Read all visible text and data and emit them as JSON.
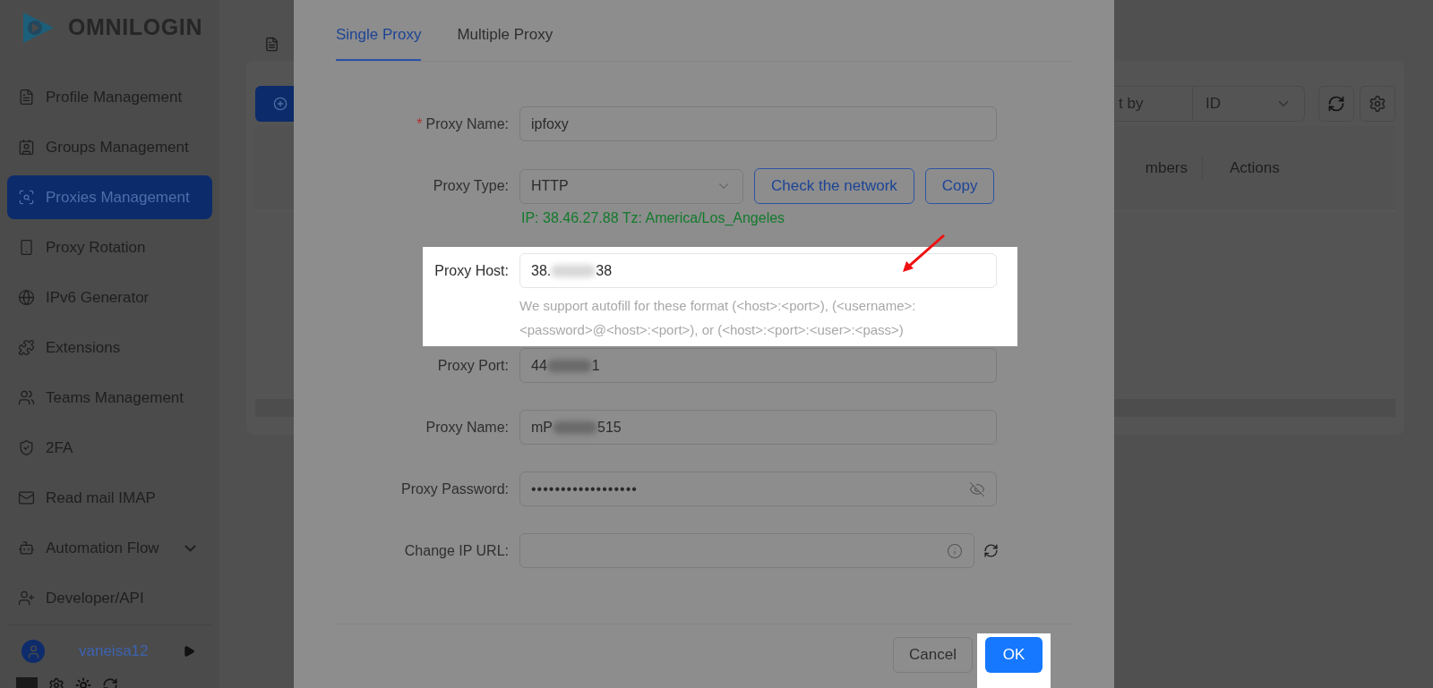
{
  "brand": {
    "name": "OMNILOGIN"
  },
  "sidebar": {
    "items": [
      {
        "label": "Profile Management",
        "selected": false,
        "has_submenu": false
      },
      {
        "label": "Groups Management",
        "selected": false,
        "has_submenu": false
      },
      {
        "label": "Proxies Management",
        "selected": true,
        "has_submenu": false
      },
      {
        "label": "Proxy Rotation",
        "selected": false,
        "has_submenu": false
      },
      {
        "label": "IPv6 Generator",
        "selected": false,
        "has_submenu": false
      },
      {
        "label": "Extensions",
        "selected": false,
        "has_submenu": false
      },
      {
        "label": "Teams Management",
        "selected": false,
        "has_submenu": false
      },
      {
        "label": "2FA",
        "selected": false,
        "has_submenu": false
      },
      {
        "label": "Read mail IMAP",
        "selected": false,
        "has_submenu": false
      },
      {
        "label": "Automation Flow",
        "selected": false,
        "has_submenu": true
      },
      {
        "label": "Developer/API",
        "selected": false,
        "has_submenu": false
      }
    ],
    "user": {
      "name": "vaneisa12"
    }
  },
  "toolbar": {
    "sort_label": "t by",
    "sort_value": "ID"
  },
  "table": {
    "columns": [
      "mbers",
      "Actions"
    ]
  },
  "dialog": {
    "tabs": [
      {
        "label": "Single Proxy",
        "selected": true
      },
      {
        "label": "Multiple Proxy",
        "selected": false
      }
    ],
    "fields": [
      {
        "kind": "text",
        "label": "Proxy Name:",
        "required_mark": "*",
        "highlighted": false,
        "value": "ipfoxy"
      },
      {
        "kind": "select",
        "label": "Proxy Type:",
        "highlighted": false,
        "value": "HTTP",
        "buttons": [
          "Check the network",
          "Copy"
        ],
        "status": "IP: 38.46.27.88 Tz: America/Los_Angeles"
      },
      {
        "kind": "redacted",
        "label": "Proxy Host:",
        "highlighted": true,
        "value_start": "38.",
        "value_end": "38",
        "hint": "We support autofill for these format (<host>:<port>), (<username>:<password>@<host>:<port>), or (<host>:<port>:<user>:<pass>)"
      },
      {
        "kind": "redacted",
        "label": "Proxy Port:",
        "highlighted": false,
        "value_start": "44",
        "value_end": "1"
      },
      {
        "kind": "redacted",
        "label": "Proxy Name:",
        "highlighted": false,
        "value_start": "mP",
        "value_end": "515"
      },
      {
        "kind": "password",
        "label": "Proxy Password:",
        "highlighted": false,
        "value": "••••••••••••••••••"
      },
      {
        "kind": "url",
        "label": "Change IP URL:",
        "highlighted": false
      }
    ],
    "footer": {
      "cancel": "Cancel",
      "ok": "OK",
      "ok_highlighted": true
    }
  }
}
